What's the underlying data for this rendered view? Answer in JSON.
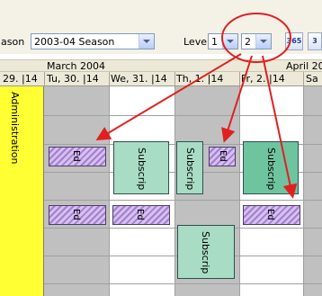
{
  "toolbar": {
    "season_label": "ason",
    "season_value": "2003-04 Season",
    "level_label": "Level",
    "level1_value": "1",
    "level2_value": "2",
    "btn_365": "365",
    "btn_3": "3"
  },
  "header": {
    "months": [
      "March 2004",
      "April 200"
    ],
    "days": [
      "29. |14",
      "Tu, 30. |14",
      "We, 31. |14",
      "Th, 1. |14",
      "Fr, 2. |14",
      "Sa"
    ]
  },
  "resource": {
    "label": "Administration"
  },
  "events": {
    "subscription": "Subscrip",
    "hatched": "Ed"
  },
  "colors": {
    "highlight_red": "#e02020",
    "admin_yellow": "#ffff33",
    "event_green": "#a8dcc4",
    "hatch_purple": "#a37fd0"
  }
}
